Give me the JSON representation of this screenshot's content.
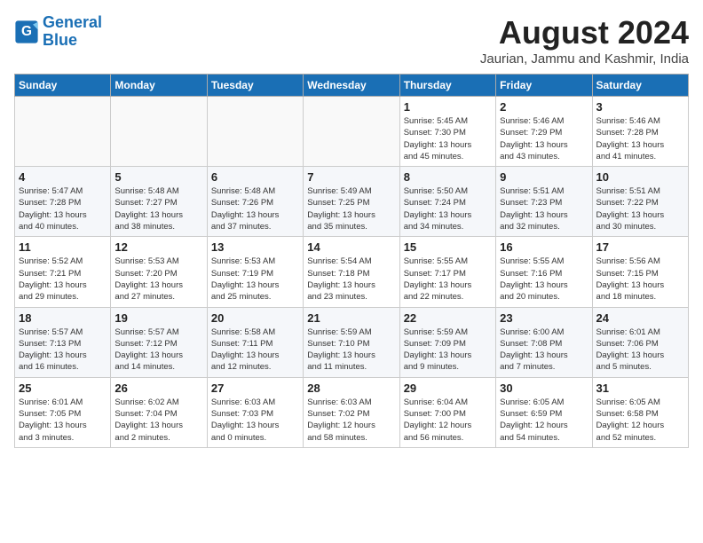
{
  "header": {
    "logo_line1": "General",
    "logo_line2": "Blue",
    "month": "August 2024",
    "location": "Jaurian, Jammu and Kashmir, India"
  },
  "weekdays": [
    "Sunday",
    "Monday",
    "Tuesday",
    "Wednesday",
    "Thursday",
    "Friday",
    "Saturday"
  ],
  "weeks": [
    [
      {
        "day": "",
        "info": ""
      },
      {
        "day": "",
        "info": ""
      },
      {
        "day": "",
        "info": ""
      },
      {
        "day": "",
        "info": ""
      },
      {
        "day": "1",
        "info": "Sunrise: 5:45 AM\nSunset: 7:30 PM\nDaylight: 13 hours\nand 45 minutes."
      },
      {
        "day": "2",
        "info": "Sunrise: 5:46 AM\nSunset: 7:29 PM\nDaylight: 13 hours\nand 43 minutes."
      },
      {
        "day": "3",
        "info": "Sunrise: 5:46 AM\nSunset: 7:28 PM\nDaylight: 13 hours\nand 41 minutes."
      }
    ],
    [
      {
        "day": "4",
        "info": "Sunrise: 5:47 AM\nSunset: 7:28 PM\nDaylight: 13 hours\nand 40 minutes."
      },
      {
        "day": "5",
        "info": "Sunrise: 5:48 AM\nSunset: 7:27 PM\nDaylight: 13 hours\nand 38 minutes."
      },
      {
        "day": "6",
        "info": "Sunrise: 5:48 AM\nSunset: 7:26 PM\nDaylight: 13 hours\nand 37 minutes."
      },
      {
        "day": "7",
        "info": "Sunrise: 5:49 AM\nSunset: 7:25 PM\nDaylight: 13 hours\nand 35 minutes."
      },
      {
        "day": "8",
        "info": "Sunrise: 5:50 AM\nSunset: 7:24 PM\nDaylight: 13 hours\nand 34 minutes."
      },
      {
        "day": "9",
        "info": "Sunrise: 5:51 AM\nSunset: 7:23 PM\nDaylight: 13 hours\nand 32 minutes."
      },
      {
        "day": "10",
        "info": "Sunrise: 5:51 AM\nSunset: 7:22 PM\nDaylight: 13 hours\nand 30 minutes."
      }
    ],
    [
      {
        "day": "11",
        "info": "Sunrise: 5:52 AM\nSunset: 7:21 PM\nDaylight: 13 hours\nand 29 minutes."
      },
      {
        "day": "12",
        "info": "Sunrise: 5:53 AM\nSunset: 7:20 PM\nDaylight: 13 hours\nand 27 minutes."
      },
      {
        "day": "13",
        "info": "Sunrise: 5:53 AM\nSunset: 7:19 PM\nDaylight: 13 hours\nand 25 minutes."
      },
      {
        "day": "14",
        "info": "Sunrise: 5:54 AM\nSunset: 7:18 PM\nDaylight: 13 hours\nand 23 minutes."
      },
      {
        "day": "15",
        "info": "Sunrise: 5:55 AM\nSunset: 7:17 PM\nDaylight: 13 hours\nand 22 minutes."
      },
      {
        "day": "16",
        "info": "Sunrise: 5:55 AM\nSunset: 7:16 PM\nDaylight: 13 hours\nand 20 minutes."
      },
      {
        "day": "17",
        "info": "Sunrise: 5:56 AM\nSunset: 7:15 PM\nDaylight: 13 hours\nand 18 minutes."
      }
    ],
    [
      {
        "day": "18",
        "info": "Sunrise: 5:57 AM\nSunset: 7:13 PM\nDaylight: 13 hours\nand 16 minutes."
      },
      {
        "day": "19",
        "info": "Sunrise: 5:57 AM\nSunset: 7:12 PM\nDaylight: 13 hours\nand 14 minutes."
      },
      {
        "day": "20",
        "info": "Sunrise: 5:58 AM\nSunset: 7:11 PM\nDaylight: 13 hours\nand 12 minutes."
      },
      {
        "day": "21",
        "info": "Sunrise: 5:59 AM\nSunset: 7:10 PM\nDaylight: 13 hours\nand 11 minutes."
      },
      {
        "day": "22",
        "info": "Sunrise: 5:59 AM\nSunset: 7:09 PM\nDaylight: 13 hours\nand 9 minutes."
      },
      {
        "day": "23",
        "info": "Sunrise: 6:00 AM\nSunset: 7:08 PM\nDaylight: 13 hours\nand 7 minutes."
      },
      {
        "day": "24",
        "info": "Sunrise: 6:01 AM\nSunset: 7:06 PM\nDaylight: 13 hours\nand 5 minutes."
      }
    ],
    [
      {
        "day": "25",
        "info": "Sunrise: 6:01 AM\nSunset: 7:05 PM\nDaylight: 13 hours\nand 3 minutes."
      },
      {
        "day": "26",
        "info": "Sunrise: 6:02 AM\nSunset: 7:04 PM\nDaylight: 13 hours\nand 2 minutes."
      },
      {
        "day": "27",
        "info": "Sunrise: 6:03 AM\nSunset: 7:03 PM\nDaylight: 13 hours\nand 0 minutes."
      },
      {
        "day": "28",
        "info": "Sunrise: 6:03 AM\nSunset: 7:02 PM\nDaylight: 12 hours\nand 58 minutes."
      },
      {
        "day": "29",
        "info": "Sunrise: 6:04 AM\nSunset: 7:00 PM\nDaylight: 12 hours\nand 56 minutes."
      },
      {
        "day": "30",
        "info": "Sunrise: 6:05 AM\nSunset: 6:59 PM\nDaylight: 12 hours\nand 54 minutes."
      },
      {
        "day": "31",
        "info": "Sunrise: 6:05 AM\nSunset: 6:58 PM\nDaylight: 12 hours\nand 52 minutes."
      }
    ]
  ]
}
